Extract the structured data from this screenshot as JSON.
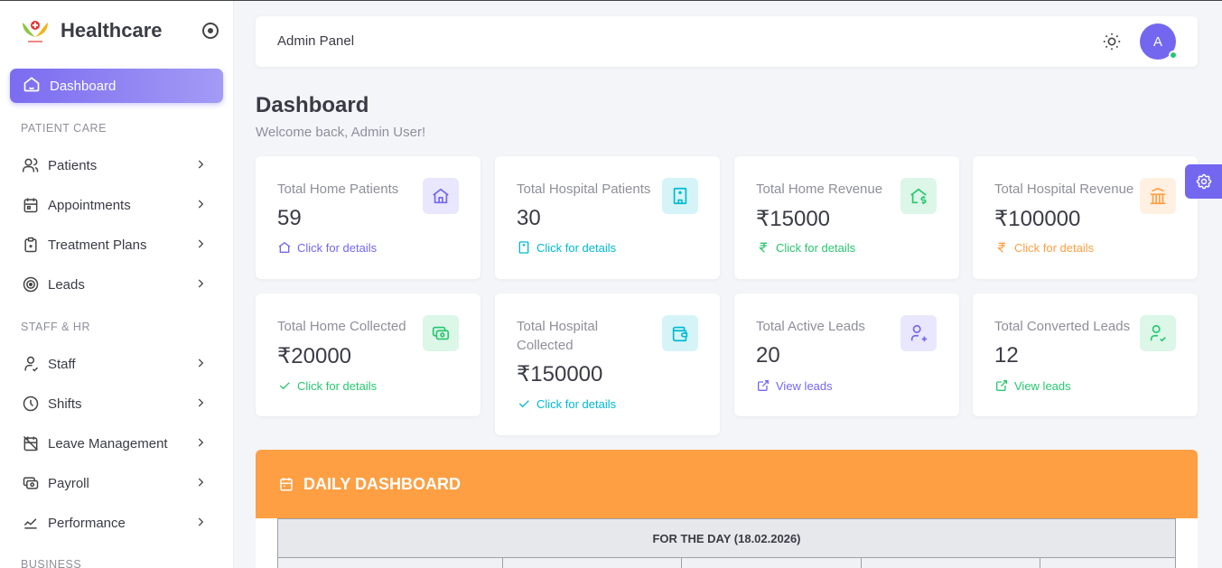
{
  "brand": {
    "name": "Healthcare"
  },
  "sidebar": {
    "active": {
      "label": "Dashboard",
      "icon": "home-icon"
    },
    "sections": [
      {
        "label": "PATIENT CARE"
      },
      {
        "label": "STAFF & HR"
      },
      {
        "label": "BUSINESS"
      }
    ],
    "items": [
      {
        "label": "Patients",
        "icon": "users-icon"
      },
      {
        "label": "Appointments",
        "icon": "calendar-icon"
      },
      {
        "label": "Treatment Plans",
        "icon": "clipboard-icon"
      },
      {
        "label": "Leads",
        "icon": "target-icon"
      },
      {
        "label": "Staff",
        "icon": "user-icon"
      },
      {
        "label": "Shifts",
        "icon": "clock-icon"
      },
      {
        "label": "Leave Management",
        "icon": "calendar-off-icon"
      },
      {
        "label": "Payroll",
        "icon": "cash-icon"
      },
      {
        "label": "Performance",
        "icon": "chart-line-icon"
      }
    ]
  },
  "topbar": {
    "title": "Admin Panel",
    "avatar_initial": "A"
  },
  "page": {
    "title": "Dashboard",
    "subtitle": "Welcome back, Admin User!"
  },
  "cards": [
    {
      "label": "Total Home Patients",
      "value": "59",
      "link": "Click for details",
      "color": "#7367f0",
      "bg": "#e9e7fd",
      "icon": "home-icon"
    },
    {
      "label": "Total Hospital Patients",
      "value": "30",
      "link": "Click for details",
      "color": "#00bad1",
      "bg": "#d6f4f8",
      "icon": "building-hospital-icon"
    },
    {
      "label": "Total Home Revenue",
      "value": "₹15000",
      "link": "Click for details",
      "color": "#28c76f",
      "bg": "#dcf6e8",
      "icon": "home-dollar-icon"
    },
    {
      "label": "Total Hospital Revenue",
      "value": "₹100000",
      "link": "Click for details",
      "color": "#ff9f43",
      "bg": "#fff0e1",
      "icon": "building-bank-icon"
    },
    {
      "label": "Total Home Collected",
      "value": "₹20000",
      "link": "Click for details",
      "color": "#28c76f",
      "bg": "#dcf6e8",
      "icon": "cash-icon"
    },
    {
      "label": "Total Hospital Collected",
      "value": "₹150000",
      "link": "Click for details",
      "color": "#00bad1",
      "bg": "#d6f4f8",
      "icon": "wallet-icon"
    },
    {
      "label": "Total Active Leads",
      "value": "20",
      "link": "View leads",
      "color": "#7367f0",
      "bg": "#e9e7fd",
      "icon": "user-plus-icon"
    },
    {
      "label": "Total Converted Leads",
      "value": "12",
      "link": "View leads",
      "color": "#28c76f",
      "bg": "#dcf6e8",
      "icon": "user-check-icon"
    }
  ],
  "daily": {
    "title": "DAILY DASHBOARD",
    "table_header": "FOR THE DAY (18.02.2026)"
  }
}
